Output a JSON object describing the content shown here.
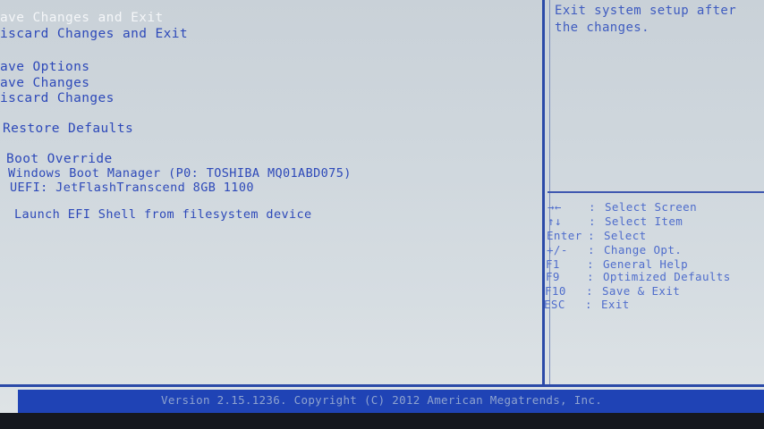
{
  "menu": {
    "save_changes_and_exit": "ave Changes and Exit",
    "discard_changes_and_exit": "iscard Changes and Exit",
    "save_options_heading": "ave Options",
    "save_changes": "ave Changes",
    "discard_changes": "iscard Changes",
    "restore_defaults": "Restore Defaults",
    "boot_override_heading": "Boot Override",
    "boot_windows": "Windows Boot Manager (P0: TOSHIBA MQ01ABD075)",
    "boot_uefi": "UEFI: JetFlashTranscend 8GB 1100",
    "launch_efi_shell": "Launch EFI Shell from filesystem device"
  },
  "help": {
    "description_line1": "Exit system setup after",
    "description_line2": "the changes."
  },
  "keys": [
    {
      "key": "→←",
      "sep": ":",
      "action": "Select Screen"
    },
    {
      "key": "↑↓",
      "sep": ":",
      "action": "Select Item"
    },
    {
      "key": "Enter",
      "sep": ":",
      "action": "Select"
    },
    {
      "key": "+/-",
      "sep": ":",
      "action": "Change Opt."
    },
    {
      "key": "F1",
      "sep": ":",
      "action": "General Help"
    },
    {
      "key": "F9",
      "sep": ":",
      "action": "Optimized Defaults"
    },
    {
      "key": "F10",
      "sep": ":",
      "action": "Save & Exit"
    },
    {
      "key": "ESC",
      "sep": ":",
      "action": "Exit"
    }
  ],
  "footer": {
    "version_text": "Version 2.15.1236. Copyright (C) 2012 American Megatrends, Inc."
  },
  "colors": {
    "highlight_text": "#f4f6f8",
    "item_text": "#2d49b9",
    "status_bar": "#1f43b5"
  }
}
